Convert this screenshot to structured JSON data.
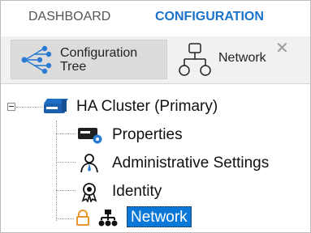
{
  "tabs": [
    {
      "label": "DASHBOARD"
    },
    {
      "label": "CONFIGURATION"
    }
  ],
  "toolbar": {
    "configuration_tree": {
      "line1": "Configuration",
      "line2": "Tree"
    },
    "network": {
      "label": "Network"
    },
    "close_glyph": "✕"
  },
  "tree": {
    "root": {
      "label": "HA Cluster (Primary)"
    },
    "children": [
      {
        "label": "Properties"
      },
      {
        "label": "Administrative Settings"
      },
      {
        "label": "Identity"
      },
      {
        "label": "Network",
        "selected": true
      }
    ]
  },
  "colors": {
    "accent": "#1a73c9",
    "selection": "#0b78d7",
    "lock": "#e8962e"
  }
}
